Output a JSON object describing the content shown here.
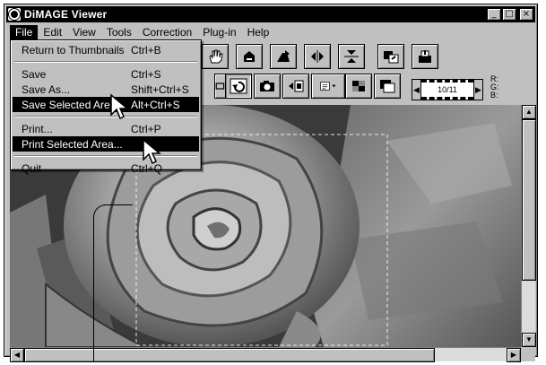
{
  "window": {
    "title": "DiMAGE Viewer",
    "controls": [
      "_",
      "□",
      "×"
    ]
  },
  "menubar": [
    {
      "label": "File",
      "active": true
    },
    {
      "label": "Edit"
    },
    {
      "label": "View"
    },
    {
      "label": "Tools"
    },
    {
      "label": "Correction"
    },
    {
      "label": "Plug-in"
    },
    {
      "label": "Help"
    }
  ],
  "file_menu": {
    "items": [
      {
        "label": "Return to Thumbnails",
        "shortcut": "Ctrl+B"
      },
      {
        "separator": true
      },
      {
        "label": "Save",
        "shortcut": "Ctrl+S"
      },
      {
        "label": "Save As...",
        "shortcut": "Shift+Ctrl+S"
      },
      {
        "label": "Save Selected Area",
        "shortcut": "Alt+Ctrl+S",
        "highlighted": true
      },
      {
        "separator": true
      },
      {
        "label": "Print...",
        "shortcut": "Ctrl+P"
      },
      {
        "label": "Print Selected Area...",
        "shortcut": "",
        "highlighted": true
      },
      {
        "separator": true
      },
      {
        "label": "Quit",
        "shortcut": "Ctrl+Q"
      }
    ]
  },
  "filmstrip": {
    "frame": "10/11"
  },
  "rgb_readout": {
    "r": "R:",
    "g": "G:",
    "b": "B:"
  },
  "colors": {
    "titlebar": "#000000",
    "highlight": "#000000",
    "face": "#c0c0c0"
  }
}
